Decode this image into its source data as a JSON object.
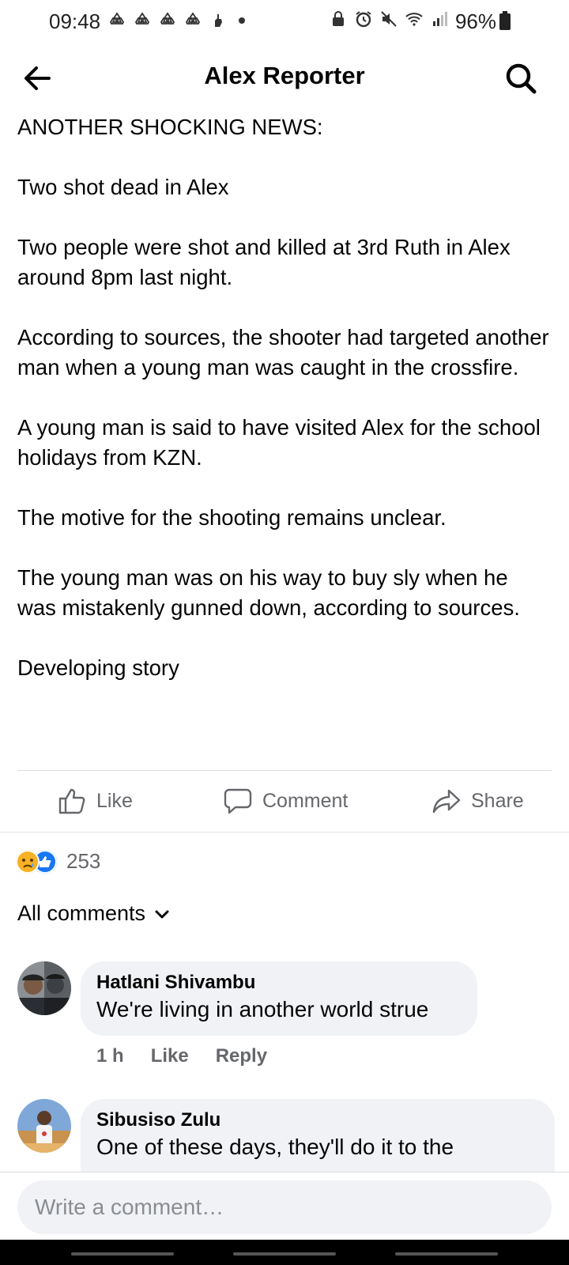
{
  "status_bar": {
    "time": "09:48",
    "battery": "96%",
    "notification_icons": [
      "recycle-icon",
      "recycle-icon",
      "recycle-icon",
      "recycle-icon",
      "hand-icon"
    ],
    "system_icons": [
      "lock-icon",
      "alarm-icon",
      "mute-icon",
      "wifi-icon",
      "signal-icon"
    ]
  },
  "header": {
    "title": "Alex Reporter"
  },
  "post": {
    "paragraphs": [
      "ANOTHER SHOCKING NEWS:",
      "Two shot dead in Alex",
      "Two people were shot and killed at 3rd Ruth in Alex around 8pm last night.",
      "According to sources, the shooter had targeted another man when a young man was caught in the crossfire.",
      "A young man is said to have visited Alex for the school holidays from KZN.",
      "The motive for the shooting remains unclear.",
      "The young man was on his way to buy sly when he was mistakenly gunned down, according to sources.",
      "Developing story"
    ]
  },
  "actions": {
    "like": "Like",
    "comment": "Comment",
    "share": "Share"
  },
  "reactions": {
    "count": "253",
    "types": [
      "sad",
      "like"
    ]
  },
  "comments_filter": "All comments",
  "comments": [
    {
      "name": "Hatlani Shivambu",
      "text": "We're living in another world strue",
      "time": "1 h",
      "like": "Like",
      "reply": "Reply"
    },
    {
      "name": "Sibusiso Zulu",
      "text": "One of these days, they'll do it to the"
    }
  ],
  "composer": {
    "placeholder": "Write a comment…"
  },
  "colors": {
    "bubble": "#f0f2f5",
    "secondary_text": "#65676b",
    "like_blue": "#1877f2",
    "sad_yellow": "#f7b125"
  }
}
